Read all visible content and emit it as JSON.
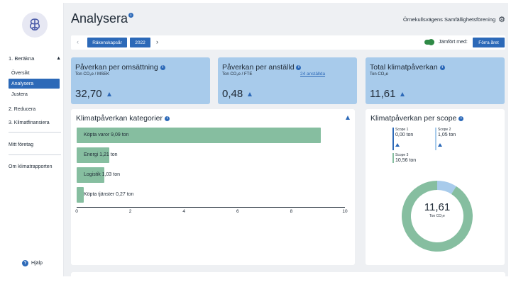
{
  "sidebar": {
    "section1_label": "1. Beräkna",
    "section1_sub": [
      "Översikt",
      "Analysera",
      "Justera"
    ],
    "section2_label": "2. Reducera",
    "section3_label": "3. Klimatfinansiera",
    "my_company": "Mitt företag",
    "about_report": "Om klimatrapporten",
    "help": "Hjälp"
  },
  "header": {
    "title": "Analysera",
    "org_name": "Örnekullsvägens Samfällighetsförening"
  },
  "filter": {
    "period_type": "Räkenskapsår",
    "year": "2022",
    "compare_label": "Jämfört med:",
    "compare_value": "Förra året",
    "compare_enabled": true
  },
  "kpis": [
    {
      "title": "Påverkan per omsättning",
      "unit": "Ton CO₂e / MSEK",
      "value": "32,70",
      "trend": "up"
    },
    {
      "title": "Påverkan per anställd",
      "unit": "Ton CO₂e / FTE",
      "link": "24 anställda",
      "value": "0,48",
      "trend": "up"
    },
    {
      "title": "Total klimatpåverkan",
      "unit": "Ton CO₂e",
      "value": "11,61",
      "trend": "up"
    }
  ],
  "categories_card": {
    "title": "Klimatpåverkan kategorier",
    "chart_data": {
      "type": "bar",
      "orientation": "horizontal",
      "categories": [
        "Köpta varor",
        "Energi",
        "Logistik",
        "Köpta tjänster"
      ],
      "values": [
        9.09,
        1.21,
        1.03,
        0.27
      ],
      "value_labels": [
        "9,09 ton",
        "1,21 ton",
        "1,03 ton",
        "0,27 ton"
      ],
      "xlim": [
        0,
        10
      ],
      "xticks": [
        0,
        2,
        4,
        6,
        8,
        10
      ],
      "bar_color": "#86bea0"
    }
  },
  "scope_card": {
    "title": "Klimatpåverkan per scope",
    "scopes": [
      {
        "label": "Scope 1",
        "value": "0,00 ton",
        "color": "#2c69b8"
      },
      {
        "label": "Scope 2",
        "value": "1,05 ton",
        "color": "#a8cbeb"
      },
      {
        "label": "Scope 3",
        "value": "10,56 ton",
        "color": "#86bea0"
      }
    ],
    "chart_data": {
      "type": "pie",
      "variant": "donut",
      "categories": [
        "Scope 1",
        "Scope 2",
        "Scope 3"
      ],
      "values": [
        0.0,
        1.05,
        10.56
      ],
      "colors": [
        "#2c69b8",
        "#a8cbeb",
        "#86bea0"
      ]
    },
    "total_value": "11,61",
    "total_unit": "Ton CO₂e"
  },
  "colors": {
    "accent": "#2c69b8",
    "kpi_bg": "#a8cbeb",
    "bar": "#86bea0",
    "toggle_on": "#2f8a46"
  }
}
